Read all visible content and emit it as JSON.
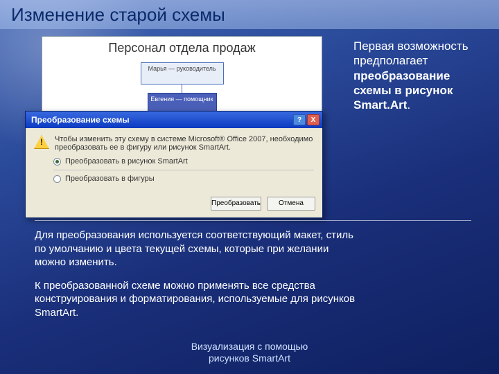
{
  "title": "Изменение старой схемы",
  "side": {
    "line1": "Первая возможность предполагает ",
    "bold": "преобразование схемы в рисунок Smart.Art",
    "suffix": "."
  },
  "org": {
    "frame_title": "Персонал отдела продаж",
    "top_box": "Марья — руководитель",
    "child_box": "Евгения — помощник"
  },
  "dialog": {
    "caption": "Преобразование схемы",
    "msg": "Чтобы изменить эту схему в системе Microsoft® Office 2007, необходимо преобразовать ее в фигуру или рисунок SmartArt.",
    "opt1": "Преобразовать в рисунок SmartArt",
    "opt2": "Преобразовать в фигуры",
    "btn_ok": "Преобразовать",
    "btn_cancel": "Отмена",
    "help": "?",
    "close": "X"
  },
  "para1": "Для преобразования используется соответствующий макет, стиль по умолчанию и цвета текущей схемы, которые при желании можно изменить.",
  "para2": "К преобразованной схеме можно применять все средства конструирования и форматирования, используемые для рисунков SmartArt.",
  "footer1": "Визуализация с помощью",
  "footer2": "рисунков SmartArt"
}
